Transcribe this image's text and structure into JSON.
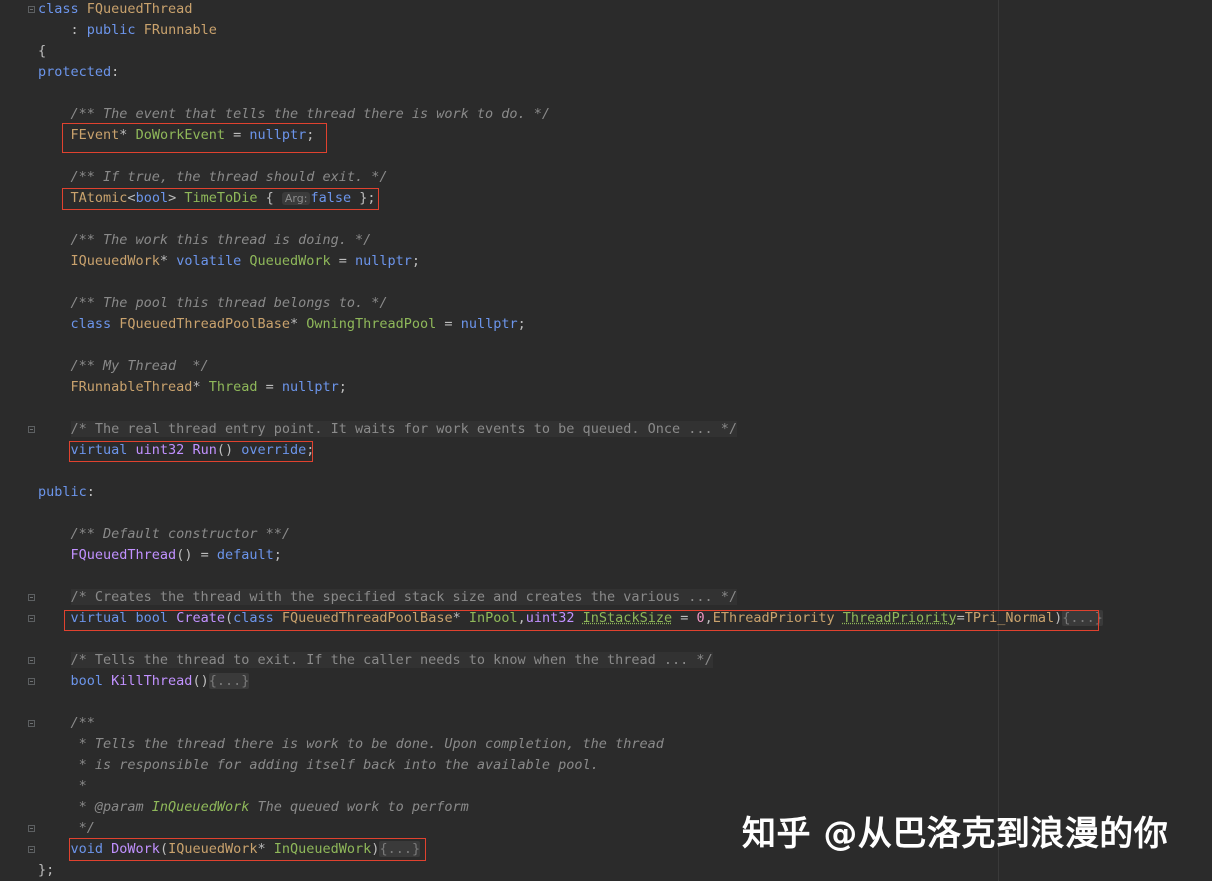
{
  "editor": {
    "lines": [
      [
        {
          "t": "class ",
          "c": "kw"
        },
        {
          "t": "FQueuedThread",
          "c": "class"
        }
      ],
      [
        {
          "t": "    : ",
          "c": "plain"
        },
        {
          "t": "public ",
          "c": "kw"
        },
        {
          "t": "FRunnable",
          "c": "class"
        }
      ],
      [
        {
          "t": "{",
          "c": "plain"
        }
      ],
      [
        {
          "t": "protected",
          "c": "kw"
        },
        {
          "t": ":",
          "c": "plain"
        }
      ],
      [],
      [
        {
          "t": "    /** The event that tells the thread there is work to do. */",
          "c": "doc"
        }
      ],
      [
        {
          "t": "    ",
          "c": "plain"
        },
        {
          "t": "FEvent",
          "c": "class"
        },
        {
          "t": "* ",
          "c": "plain"
        },
        {
          "t": "DoWorkEvent",
          "c": "var"
        },
        {
          "t": " = ",
          "c": "plain"
        },
        {
          "t": "nullptr",
          "c": "kw"
        },
        {
          "t": ";",
          "c": "plain"
        }
      ],
      [],
      [
        {
          "t": "    /** If true, the thread should exit. */",
          "c": "doc"
        }
      ],
      [
        {
          "t": "    ",
          "c": "plain"
        },
        {
          "t": "TAtomic",
          "c": "class"
        },
        {
          "t": "<",
          "c": "plain"
        },
        {
          "t": "bool",
          "c": "kw"
        },
        {
          "t": "> ",
          "c": "plain"
        },
        {
          "t": "TimeToDie",
          "c": "var"
        },
        {
          "t": " { ",
          "c": "plain"
        },
        {
          "t": "Arg:",
          "c": "hint"
        },
        {
          "t": "false",
          "c": "kw"
        },
        {
          "t": " };",
          "c": "plain"
        }
      ],
      [],
      [
        {
          "t": "    /** The work this thread is doing. */",
          "c": "doc"
        }
      ],
      [
        {
          "t": "    ",
          "c": "plain"
        },
        {
          "t": "IQueuedWork",
          "c": "class"
        },
        {
          "t": "* ",
          "c": "plain"
        },
        {
          "t": "volatile ",
          "c": "kw"
        },
        {
          "t": "QueuedWork",
          "c": "var"
        },
        {
          "t": " = ",
          "c": "plain"
        },
        {
          "t": "nullptr",
          "c": "kw"
        },
        {
          "t": ";",
          "c": "plain"
        }
      ],
      [],
      [
        {
          "t": "    /** The pool this thread belongs to. */",
          "c": "doc"
        }
      ],
      [
        {
          "t": "    ",
          "c": "plain"
        },
        {
          "t": "class ",
          "c": "kw"
        },
        {
          "t": "FQueuedThreadPoolBase",
          "c": "class"
        },
        {
          "t": "* ",
          "c": "plain"
        },
        {
          "t": "OwningThreadPool",
          "c": "var"
        },
        {
          "t": " = ",
          "c": "plain"
        },
        {
          "t": "nullptr",
          "c": "kw"
        },
        {
          "t": ";",
          "c": "plain"
        }
      ],
      [],
      [
        {
          "t": "    /** My Thread  */",
          "c": "doc"
        }
      ],
      [
        {
          "t": "    ",
          "c": "plain"
        },
        {
          "t": "FRunnableThread",
          "c": "class"
        },
        {
          "t": "* ",
          "c": "plain"
        },
        {
          "t": "Thread",
          "c": "var"
        },
        {
          "t": " = ",
          "c": "plain"
        },
        {
          "t": "nullptr",
          "c": "kw"
        },
        {
          "t": ";",
          "c": "plain"
        }
      ],
      [],
      [
        {
          "t": "    ",
          "c": "plain"
        },
        {
          "t": "/* The real thread entry point. It waits for work events to be queued. Once ... */",
          "c": "blockc"
        }
      ],
      [
        {
          "t": "    ",
          "c": "plain"
        },
        {
          "t": "virtual ",
          "c": "kw"
        },
        {
          "t": "uint32 ",
          "c": "type"
        },
        {
          "t": "Run",
          "c": "type"
        },
        {
          "t": "() ",
          "c": "plain"
        },
        {
          "t": "override",
          "c": "kw"
        },
        {
          "t": ";",
          "c": "plain"
        }
      ],
      [],
      [
        {
          "t": "public",
          "c": "kw"
        },
        {
          "t": ":",
          "c": "plain"
        }
      ],
      [],
      [
        {
          "t": "    /** Default constructor **/",
          "c": "doc"
        }
      ],
      [
        {
          "t": "    ",
          "c": "plain"
        },
        {
          "t": "FQueuedThread",
          "c": "type"
        },
        {
          "t": "() = ",
          "c": "plain"
        },
        {
          "t": "default",
          "c": "kw"
        },
        {
          "t": ";",
          "c": "plain"
        }
      ],
      [],
      [
        {
          "t": "    ",
          "c": "plain"
        },
        {
          "t": "/* Creates the thread with the specified stack size and creates the various ... */",
          "c": "blockc"
        }
      ],
      [
        {
          "t": "    ",
          "c": "plain"
        },
        {
          "t": "virtual ",
          "c": "kw"
        },
        {
          "t": "bool ",
          "c": "kw"
        },
        {
          "t": "Create",
          "c": "type"
        },
        {
          "t": "(",
          "c": "plain"
        },
        {
          "t": "class ",
          "c": "kw"
        },
        {
          "t": "FQueuedThreadPoolBase",
          "c": "class"
        },
        {
          "t": "* ",
          "c": "plain"
        },
        {
          "t": "InPool",
          "c": "var"
        },
        {
          "t": ",",
          "c": "plain"
        },
        {
          "t": "uint32 ",
          "c": "type"
        },
        {
          "t": "InStackSize",
          "c": "squig"
        },
        {
          "t": " = ",
          "c": "plain"
        },
        {
          "t": "0",
          "c": "num"
        },
        {
          "t": ",",
          "c": "plain"
        },
        {
          "t": "EThreadPriority ",
          "c": "enum"
        },
        {
          "t": "ThreadPriority",
          "c": "squig"
        },
        {
          "t": "=",
          "c": "plain"
        },
        {
          "t": "TPri_Normal",
          "c": "enum"
        },
        {
          "t": ")",
          "c": "plain"
        },
        {
          "t": "{...}",
          "c": "folded"
        }
      ],
      [],
      [
        {
          "t": "    ",
          "c": "plain"
        },
        {
          "t": "/* Tells the thread to exit. If the caller needs to know when the thread ... */",
          "c": "blockc"
        }
      ],
      [
        {
          "t": "    ",
          "c": "plain"
        },
        {
          "t": "bool ",
          "c": "kw"
        },
        {
          "t": "KillThread",
          "c": "type"
        },
        {
          "t": "()",
          "c": "plain"
        },
        {
          "t": "{...}",
          "c": "folded"
        }
      ],
      [],
      [
        {
          "t": "    /**",
          "c": "doc"
        }
      ],
      [
        {
          "t": "     * Tells the thread there is work to be done. Upon completion, the thread",
          "c": "doc"
        }
      ],
      [
        {
          "t": "     * is responsible for adding itself back into the available pool.",
          "c": "doc"
        }
      ],
      [
        {
          "t": "     *",
          "c": "doc"
        }
      ],
      [
        {
          "t": "     * @param ",
          "c": "doc"
        },
        {
          "t": "InQueuedWork",
          "c": "docparam"
        },
        {
          "t": " The queued work to perform",
          "c": "doc"
        }
      ],
      [
        {
          "t": "     */",
          "c": "doc"
        }
      ],
      [
        {
          "t": "    ",
          "c": "plain"
        },
        {
          "t": "void ",
          "c": "kw"
        },
        {
          "t": "DoWork",
          "c": "type"
        },
        {
          "t": "(",
          "c": "plain"
        },
        {
          "t": "IQueuedWork",
          "c": "class"
        },
        {
          "t": "* ",
          "c": "plain"
        },
        {
          "t": "InQueuedWork",
          "c": "var"
        },
        {
          "t": ")",
          "c": "plain"
        },
        {
          "t": "{...}",
          "c": "folded"
        }
      ],
      [
        {
          "t": "};",
          "c": "plain"
        }
      ]
    ]
  },
  "watermark": "知乎 @从巴洛克到浪漫的你",
  "colors": {
    "background": "#2b2b2b",
    "highlight_box": "#e0422f"
  }
}
